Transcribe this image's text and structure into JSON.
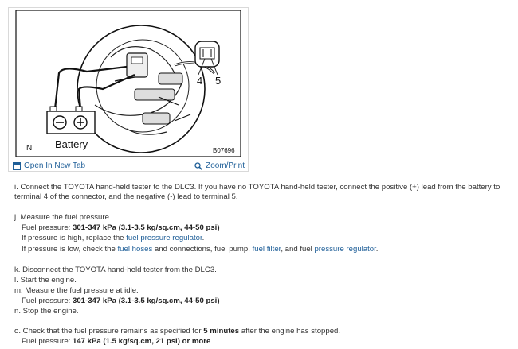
{
  "figure": {
    "label_4": "4",
    "label_5": "5",
    "battery_label": "Battery",
    "corner_label": "N",
    "code_label": "B07696",
    "open_tab": "Open In New Tab",
    "zoom_print": "Zoom/Print"
  },
  "steps": {
    "i": {
      "text": "i. Connect the TOYOTA hand-held tester to the DLC3. If you have no TOYOTA hand-held tester, connect the positive (+) lead from the battery to terminal 4 of the connector, and the negative (-) lead to terminal 5."
    },
    "j": {
      "line1": "j. Measure the fuel pressure.",
      "pressure_label": "Fuel pressure: ",
      "pressure_value": "301-347 kPa (3.1-3.5 kg/sq.cm, 44-50 psi)",
      "high_pre": "If pressure is high, replace the ",
      "high_link": "fuel pressure regulator",
      "high_post": ".",
      "low_pre": "If pressure is low, check the ",
      "low_link1": "fuel hoses",
      "low_mid1": " and connections, fuel pump, ",
      "low_link2": "fuel filter",
      "low_mid2": ", and fuel ",
      "low_link3": "pressure regulator",
      "low_post": "."
    },
    "k": "k. Disconnect the TOYOTA hand-held tester from the DLC3.",
    "l": "l. Start the engine.",
    "m": {
      "line1": "m. Measure the fuel pressure at idle.",
      "pressure_label": "Fuel pressure: ",
      "pressure_value": "301-347 kPa (3.1-3.5 kg/sq.cm, 44-50 psi)"
    },
    "n": "n. Stop the engine.",
    "o": {
      "pre": "o. Check that the fuel pressure remains as specified for ",
      "bold": "5 minutes",
      "post": " after the engine has stopped.",
      "pressure_label": "Fuel pressure: ",
      "pressure_value": "147 kPa (1.5 kg/sq.cm, 21 psi) or more"
    }
  }
}
